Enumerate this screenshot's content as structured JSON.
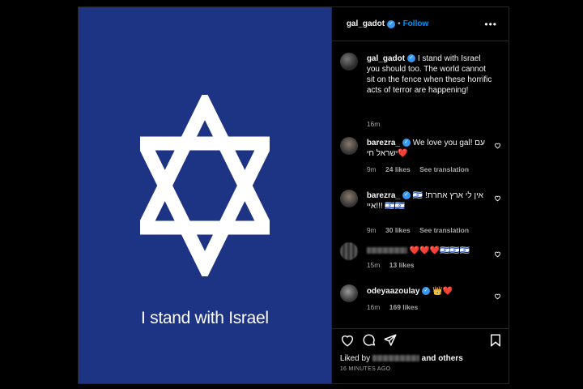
{
  "media": {
    "caption": "I stand with Israel",
    "background_color": "#1d3384",
    "icon": "star-of-david-icon"
  },
  "header": {
    "username": "gal_gadot",
    "separator": "•",
    "follow_label": "Follow",
    "more_label": "•••"
  },
  "caption_post": {
    "username": "gal_gadot",
    "text": " I stand with Israel you should too. The world cannot sit on the fence when these horrific acts of terror are happening!",
    "time": "16m"
  },
  "comments": [
    {
      "username": "barezra_",
      "text": " We love you gal! עם ישראל חי❤️",
      "time": "9m",
      "likes": "24 likes",
      "reply": "See translation"
    },
    {
      "username": "barezra_",
      "text": " 🇮🇱 אין לי ארץ אחרת! איי!!! 🇮🇱🇮🇱",
      "time": "9m",
      "likes": "30 likes",
      "reply": "See translation"
    },
    {
      "username": "",
      "text": " ❤️❤️❤️🇮🇱🇮🇱🇮🇱",
      "time": "15m",
      "likes": "13 likes",
      "reply": ""
    },
    {
      "username": "odeyaazoulay",
      "text": " 👑❤️",
      "time": "16m",
      "likes": "169 likes",
      "reply": ""
    }
  ],
  "footer": {
    "liked_by_prefix": "Liked by",
    "liked_by_suffix": "and others",
    "time_ago": "16 MINUTES AGO"
  },
  "colors": {
    "verified": "#3897f0",
    "follow": "#0095f6",
    "muted": "#a8a8a8"
  }
}
